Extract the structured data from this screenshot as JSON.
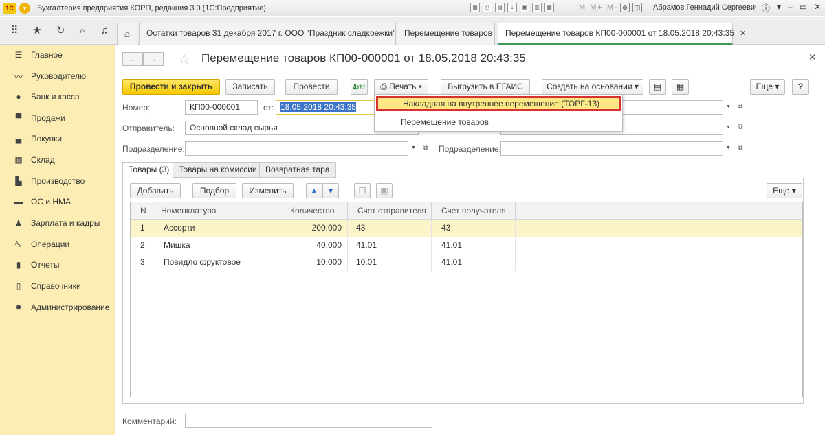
{
  "app": {
    "title": "Бухгалтерия предприятия КОРП, редакция 3.0  (1С:Предприятие)",
    "logo": "1С",
    "user": "Абрамов Геннадий Сергеевич",
    "mem": "M  M+  M-"
  },
  "tabs": [
    {
      "label": "Остатки товаров 31 декабря 2017 г. ООО \"Праздник сладкоежки\""
    },
    {
      "label": "Перемещение товаров"
    },
    {
      "label": "Перемещение товаров КП00-000001 от 18.05.2018 20:43:35"
    }
  ],
  "sidebar": {
    "items": [
      {
        "label": "Главное",
        "icon": "menu-lines-icon"
      },
      {
        "label": "Руководителю",
        "icon": "chart-trend-icon"
      },
      {
        "label": "Банк и касса",
        "icon": "coin-icon"
      },
      {
        "label": "Продажи",
        "icon": "basket-icon"
      },
      {
        "label": "Покупки",
        "icon": "cart-icon"
      },
      {
        "label": "Склад",
        "icon": "warehouse-icon"
      },
      {
        "label": "Производство",
        "icon": "factory-icon"
      },
      {
        "label": "ОС и НМА",
        "icon": "truck-icon"
      },
      {
        "label": "Зарплата и кадры",
        "icon": "person-icon"
      },
      {
        "label": "Операции",
        "icon": "dt-kt-icon"
      },
      {
        "label": "Отчеты",
        "icon": "bar-chart-icon"
      },
      {
        "label": "Справочники",
        "icon": "book-icon"
      },
      {
        "label": "Администрирование",
        "icon": "gear-icon"
      }
    ]
  },
  "doc": {
    "title": "Перемещение товаров КП00-000001 от 18.05.2018 20:43:35",
    "toolbar": {
      "post_close": "Провести и закрыть",
      "save": "Записать",
      "post": "Провести",
      "print": "Печать",
      "egais": "Выгрузить в ЕГАИС",
      "create_based": "Создать на основании",
      "more": "Еще",
      "help": "?"
    },
    "fields": {
      "number_label": "Номер:",
      "number": "КП00-000001",
      "date_label": "от:",
      "date": "18.05.2018 20:43:35",
      "sender_label": "Отправитель:",
      "sender": "Основной склад сырья",
      "dept_label": "Подразделение:",
      "dept": "",
      "dept2_label": "Подразделение:",
      "dept2": "",
      "comment_label": "Комментарий:",
      "comment": ""
    },
    "form_tabs": [
      "Товары (3)",
      "Товары на комиссии",
      "Возвратная тара"
    ],
    "table_toolbar": {
      "add": "Добавить",
      "pick": "Подбор",
      "change": "Изменить",
      "more": "Еще"
    },
    "table": {
      "columns": [
        "N",
        "Номенклатура",
        "Количество",
        "Счет отправителя",
        "Счет получателя"
      ],
      "rows": [
        {
          "n": "1",
          "name": "Ассорти",
          "qty": "200,000",
          "acc_from": "43",
          "acc_to": "43"
        },
        {
          "n": "2",
          "name": "Мишка",
          "qty": "40,000",
          "acc_from": "41.01",
          "acc_to": "41.01"
        },
        {
          "n": "3",
          "name": "Повидло фруктовое",
          "qty": "10,000",
          "acc_from": "10.01",
          "acc_to": "41.01"
        }
      ]
    }
  },
  "print_menu": {
    "items": [
      "Накладная на внутреннее перемещение (ТОРГ-13)",
      "Перемещение товаров"
    ]
  },
  "colors": {
    "sidebar_bg": "#fbedb4",
    "primary_button": "#f5c800",
    "active_tab_underline": "#3c9c58",
    "selected_row": "#fbf4c8",
    "highlight_border": "#d93030"
  }
}
